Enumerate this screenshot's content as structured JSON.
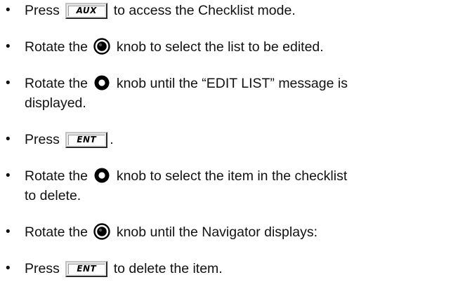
{
  "steps": [
    {
      "bullet": "•",
      "pre": "Press",
      "key": "AUX",
      "post": "to access the Checklist mode."
    },
    {
      "bullet": "•",
      "pre": "Rotate the",
      "knob": "small-knob-icon",
      "post": "knob to select the list to be edited."
    },
    {
      "bullet": "•",
      "pre": "Rotate the",
      "knob": "large-knob-icon",
      "post": "knob until the “EDIT LIST” message is",
      "post2": "displayed."
    },
    {
      "bullet": "•",
      "pre": "Press",
      "key": "ENT",
      "post": "."
    },
    {
      "bullet": "•",
      "pre": "Rotate the",
      "knob": "large-knob-icon",
      "post": "knob to select the item in the checklist",
      "post2": "to delete."
    },
    {
      "bullet": "•",
      "pre": "Rotate the",
      "knob": "small-knob-icon",
      "post": "knob until the Navigator displays:"
    },
    {
      "bullet": "•",
      "pre": "Press",
      "key": "ENT",
      "post": "to delete the item."
    }
  ]
}
